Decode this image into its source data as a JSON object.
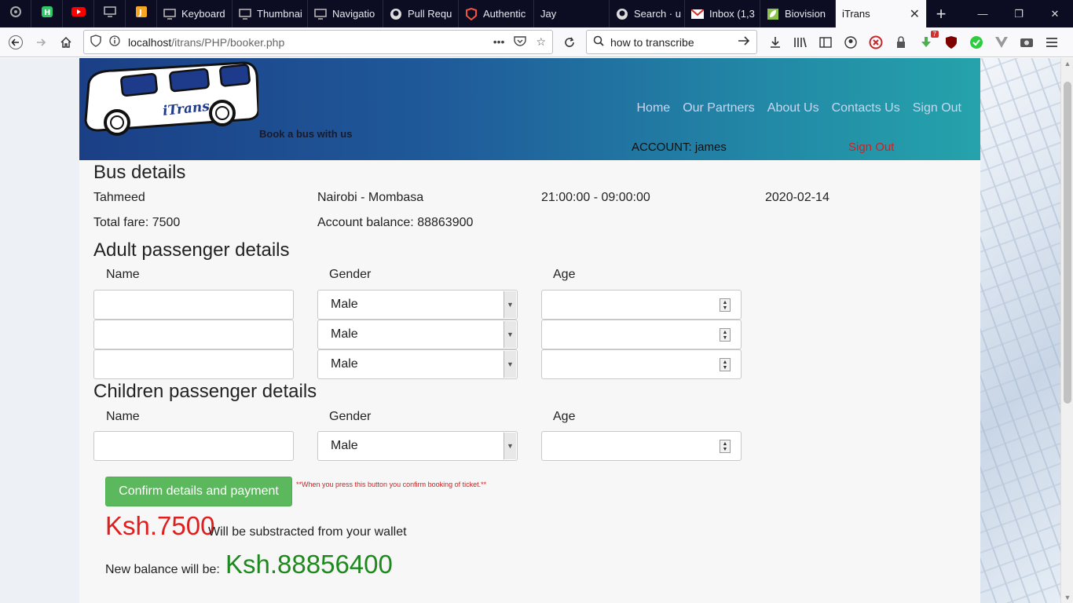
{
  "browser": {
    "tabs": [
      {
        "label": "Keyboard",
        "icon": "monitor-icon"
      },
      {
        "label": "Thumbnai",
        "icon": "monitor-icon"
      },
      {
        "label": "Navigatio",
        "icon": "monitor-icon"
      },
      {
        "label": "Pull Requ",
        "icon": "github-icon"
      },
      {
        "label": "Authentic",
        "icon": "laravel-icon"
      },
      {
        "label": "Jay",
        "icon": ""
      },
      {
        "label": "Search · u",
        "icon": "github-icon"
      },
      {
        "label": "Inbox (1,3",
        "icon": "gmail-icon"
      },
      {
        "label": "Biovision",
        "icon": "leaf-icon"
      }
    ],
    "active_tab": "iTrans",
    "url_host": "localhost",
    "url_path": "/itrans/PHP/booker.php",
    "search_text": "how to transcribe",
    "badge_count": "7"
  },
  "header": {
    "brand": "iTrans",
    "tagline": "Book a bus with us",
    "nav": [
      "Home",
      "Our Partners",
      "About Us",
      "Contacts Us",
      "Sign Out"
    ],
    "account_label": "ACCOUNT: james",
    "signout_label": "Sign Out"
  },
  "bus": {
    "heading": "Bus details",
    "bus_name": "Tahmeed",
    "route": "Nairobi - Mombasa",
    "time": "21:00:00 - 09:00:00",
    "date": "2020-02-14",
    "total_fare": "Total fare: 7500",
    "account_balance": "Account balance: 88863900"
  },
  "adults": {
    "heading": "Adult passenger details",
    "col_name": "Name",
    "col_gender": "Gender",
    "col_age": "Age",
    "rows": [
      {
        "name": "",
        "gender": "Male",
        "age": ""
      },
      {
        "name": "",
        "gender": "Male",
        "age": ""
      },
      {
        "name": "",
        "gender": "Male",
        "age": ""
      }
    ]
  },
  "children": {
    "heading": "Children passenger details",
    "col_name": "Name",
    "col_gender": "Gender",
    "col_age": "Age",
    "rows": [
      {
        "name": "",
        "gender": "Male",
        "age": ""
      }
    ]
  },
  "payment": {
    "button_label": "Confirm details and payment",
    "warning": "**When you press this button you confirm booking of ticket.**",
    "deduct_amount": "Ksh.7500",
    "deduct_text": "Will be substracted from your wallet",
    "new_balance_label": "New balance will be:",
    "new_balance_amount": "Ksh.88856400"
  },
  "colors": {
    "confirm_button": "#5cb85c",
    "deduct_amount": "#e01e1e",
    "new_balance": "#1e8a1e",
    "signout": "#d21f1f"
  }
}
